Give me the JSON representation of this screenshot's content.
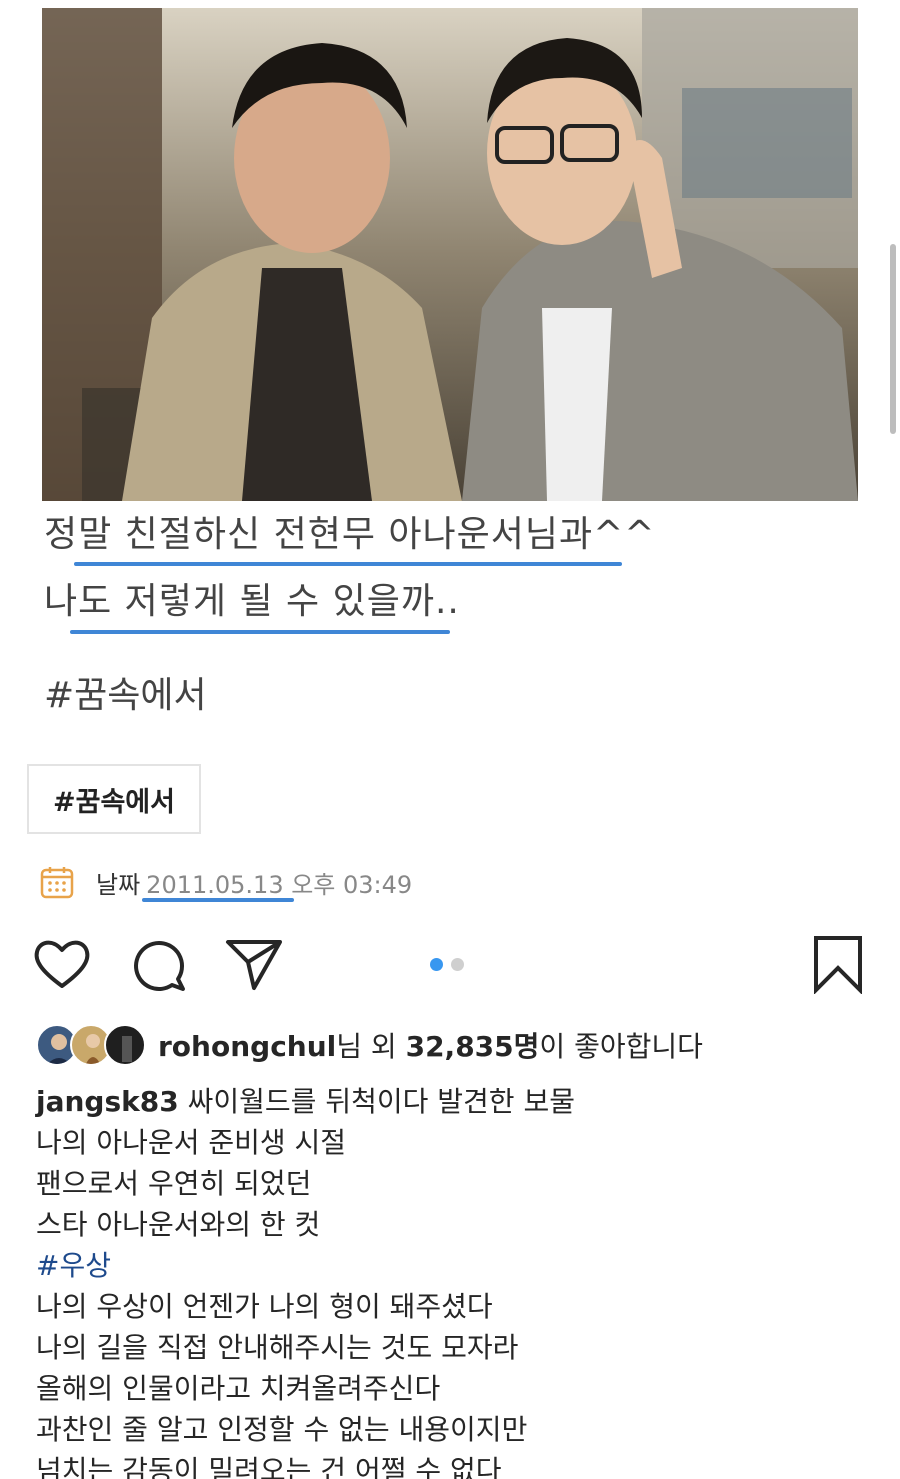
{
  "embedded_post": {
    "caption_lines": [
      "정말 친절하신 전현무 아나운서님과^^",
      "나도 저렇게 될 수 있을까.."
    ],
    "hashtag_text": "#꿈속에서",
    "tag_chip": "#꿈속에서",
    "date_label": "날짜",
    "date_value": "2011.05.13 오후 03:49",
    "highlight_color": "#3f86d6"
  },
  "actions": {
    "icons": [
      "heart-icon",
      "comment-icon",
      "share-icon",
      "bookmark-icon"
    ],
    "carousel": {
      "count": 2,
      "active": 1
    }
  },
  "likes": {
    "user": "rohongchul",
    "mid": "님 외 ",
    "count": "32,835명",
    "suffix": "이 좋아합니다"
  },
  "caption": {
    "username": "jangsk83",
    "first_line": " 싸이월드를 뒤척이다 발견한 보물",
    "lines": [
      "나의 아나운서 준비생 시절",
      "팬으로서 우연히 되었던",
      "스타 아나운서와의 한 컷"
    ],
    "hashtag": "#우상",
    "lines2": [
      "나의 우상이 언젠가 나의 형이 돼주셨다",
      "나의 길을 직접 안내해주시는 것도 모자라",
      "올해의 인물이라고 치켜올려주신다",
      "과찬인 줄 알고 인정할 수 없는 내용이지만",
      "넘치는 감동이 밀려오는 건 어쩔 수 없다"
    ]
  }
}
